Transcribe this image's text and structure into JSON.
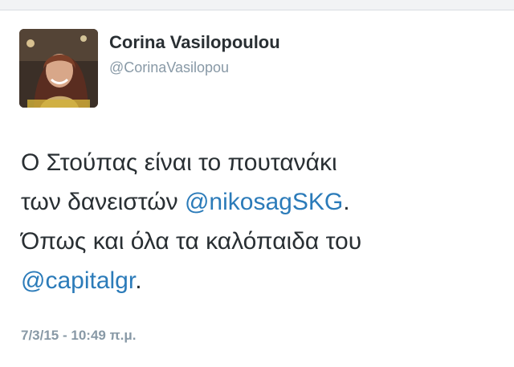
{
  "tweet": {
    "author": {
      "name": "Corina Vasilopoulou",
      "handle": "@CorinaVasilopou"
    },
    "text": {
      "line1": "Ο Στούπας είναι το πουτανάκι",
      "line2_prefix": "των δανειστών ",
      "mention1": "@nikosagSKG",
      "line2_suffix": ".",
      "line3": "Όπως και όλα τα καλόπαιδα του",
      "mention2": "@capitalgr",
      "line4_suffix": "."
    },
    "date": "7/3/15",
    "separator": " - ",
    "time": "10:49 π.μ."
  }
}
